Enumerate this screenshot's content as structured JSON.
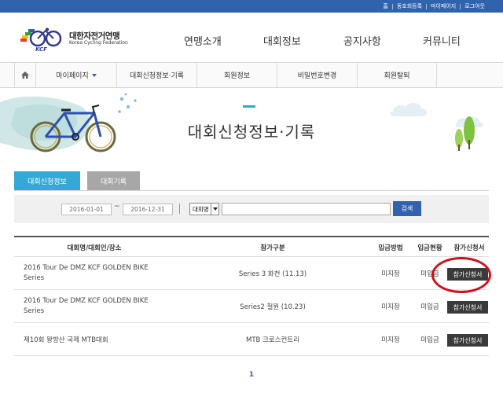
{
  "top_links": [
    "홈",
    "동호회등록",
    "마이페이지",
    "로그아웃"
  ],
  "logo": {
    "korean": "대한자전거연맹",
    "english": "Korea Cycling Federation",
    "abbr": "KCF"
  },
  "gnb": [
    "연맹소개",
    "대회정보",
    "공지사항",
    "커뮤니티"
  ],
  "subnav": {
    "home_icon": "home-icon",
    "items": [
      "마이페이지",
      "대회신청정보·기록",
      "회원정보",
      "비밀번호변경",
      "회원탈퇴"
    ]
  },
  "banner": {
    "title": "대회신청정보·기록"
  },
  "tabs": [
    "대회신청정보",
    "대회기록"
  ],
  "search": {
    "date_from": "2016-01-01",
    "date_to": "2016-12-31",
    "tilde": "~",
    "select_value": "대회명",
    "keyword": "",
    "button": "검색"
  },
  "table": {
    "headers": [
      "대회명/대회인/장소",
      "참가구분",
      "입금방법",
      "입금현황",
      "참가신청서"
    ],
    "rows": [
      {
        "name": "2016 Tour De DMZ KCF GOLDEN BIKE Series",
        "category": "Series 3 화천 (11.13)",
        "method": "미지정",
        "status": "미입금",
        "action": "참가신청서"
      },
      {
        "name": "2016 Tour De DMZ KCF GOLDEN BIKE Series",
        "category": "Series2 철원 (10.23)",
        "method": "미지정",
        "status": "미입금",
        "action": "참가신청서"
      },
      {
        "name": "제10회 왕방산 국제 MTB대회",
        "category": "MTB 크로스컨트리",
        "method": "미지정",
        "status": "미입금",
        "action": "참가신청서"
      }
    ]
  },
  "pagination": {
    "current": "1"
  },
  "colors": {
    "primary": "#2f63ad",
    "tab_active": "#34a9d6",
    "highlight": "#d0101b"
  }
}
